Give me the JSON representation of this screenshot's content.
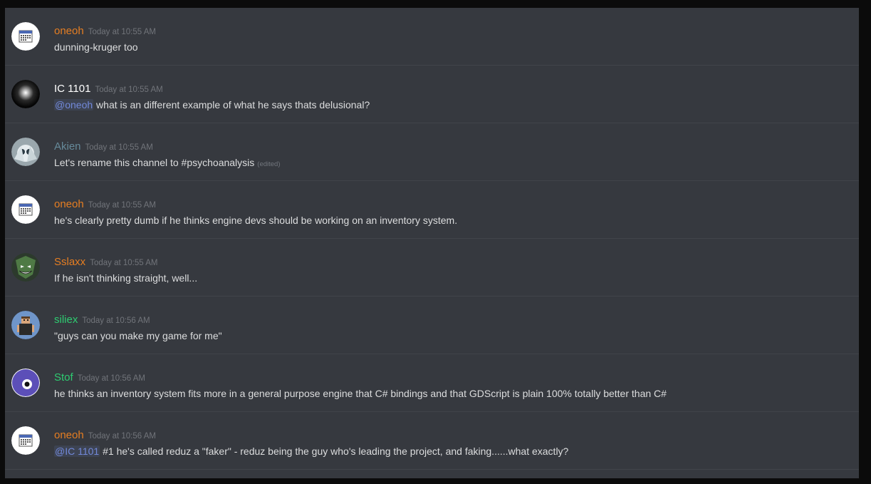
{
  "messages": [
    {
      "username": "oneoh",
      "name_color": "#e67e22",
      "timestamp": "Today at 10:55 AM",
      "avatar": "calendar-icon",
      "mention": "",
      "text": "dunning-kruger too",
      "edited": ""
    },
    {
      "username": "IC 1101",
      "name_color": "#ffffff",
      "timestamp": "Today at 10:55 AM",
      "avatar": "galaxy-avatar",
      "mention": "@oneoh",
      "text": " what is an different example of what he says thats delusional?",
      "edited": ""
    },
    {
      "username": "Akien",
      "name_color": "#668a9a",
      "timestamp": "Today at 10:55 AM",
      "avatar": "robot-avatar",
      "mention": "",
      "text": "Let's rename this channel to #psychoanalysis",
      "edited": "(edited)"
    },
    {
      "username": "oneoh",
      "name_color": "#e67e22",
      "timestamp": "Today at 10:55 AM",
      "avatar": "calendar-icon",
      "mention": "",
      "text": "he's clearly pretty dumb if he thinks engine devs should be working on an inventory system.",
      "edited": ""
    },
    {
      "username": "Sslaxx",
      "name_color": "#e67e22",
      "timestamp": "Today at 10:55 AM",
      "avatar": "goblin-avatar",
      "mention": "",
      "text": "If he isn't thinking straight, well...",
      "edited": ""
    },
    {
      "username": "siliex",
      "name_color": "#2ecc71",
      "timestamp": "Today at 10:56 AM",
      "avatar": "pixel-avatar",
      "mention": "",
      "text": "\"guys can you make my game for me\"",
      "edited": ""
    },
    {
      "username": "Stof",
      "name_color": "#2ecc71",
      "timestamp": "Today at 10:56 AM",
      "avatar": "eye-avatar",
      "mention": "",
      "text": "he thinks an inventory system fits more in a general purpose engine that C# bindings and that GDScript is plain 100% totally better than C#",
      "edited": ""
    },
    {
      "username": "oneoh",
      "name_color": "#e67e22",
      "timestamp": "Today at 10:56 AM",
      "avatar": "calendar-icon",
      "mention": "@IC 1101",
      "text": " #1 he's called reduz a \"faker\" - reduz being the guy who's leading the project, and faking......what exactly?",
      "edited": ""
    }
  ]
}
